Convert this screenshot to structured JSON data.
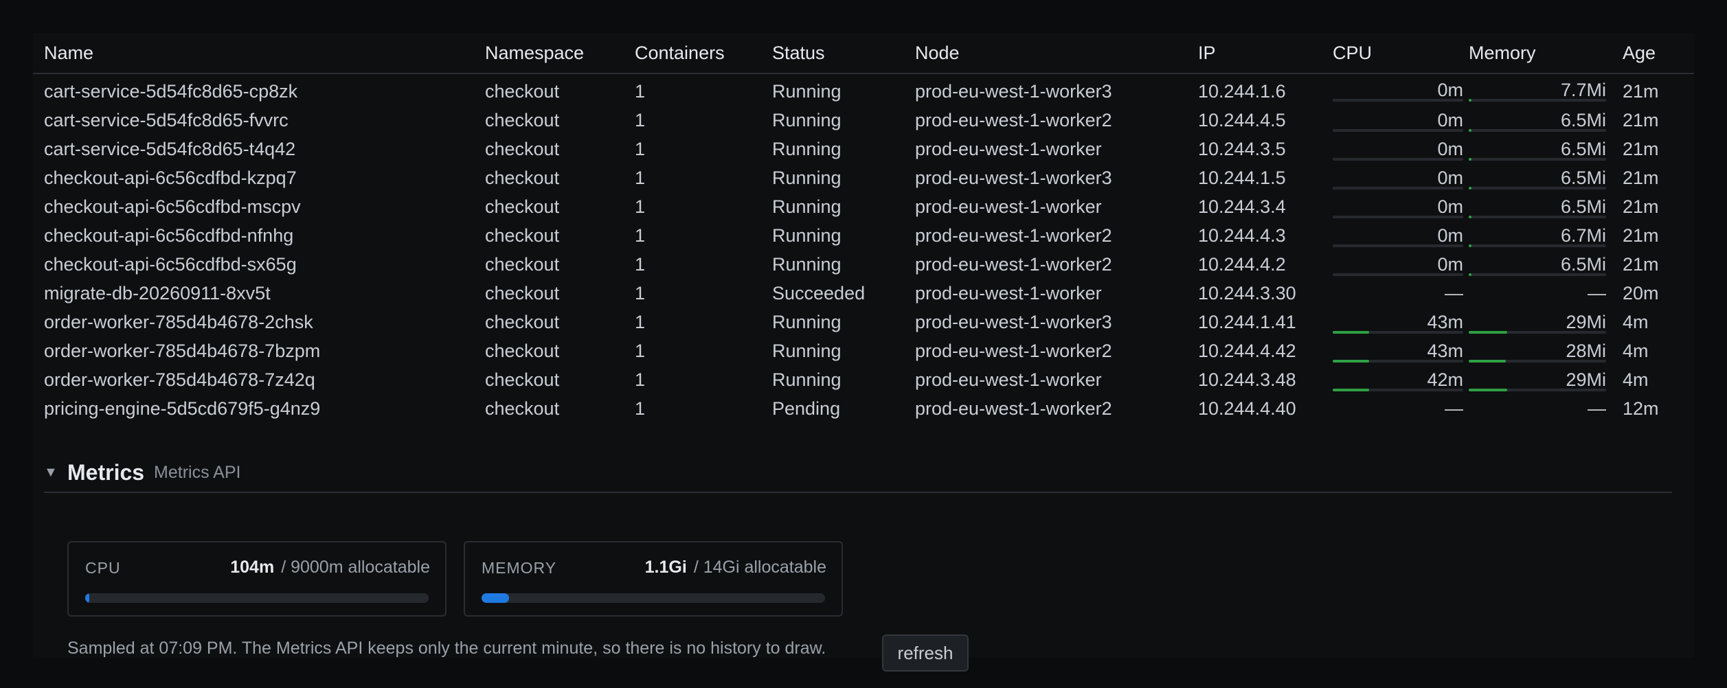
{
  "table": {
    "columns": {
      "name": "Name",
      "namespace": "Namespace",
      "containers": "Containers",
      "status": "Status",
      "node": "Node",
      "ip": "IP",
      "cpu": "CPU",
      "memory": "Memory",
      "age": "Age"
    },
    "rows": [
      {
        "name": "cart-service-5d54fc8d65-cp8zk",
        "namespace": "checkout",
        "containers": "1",
        "status": "Running",
        "node": "prod-eu-west-1-worker3",
        "ip": "10.244.1.6",
        "cpu": "0m",
        "cpu_level": 0.0,
        "memory": "7.7Mi",
        "mem_level": 0.01,
        "age": "21m"
      },
      {
        "name": "cart-service-5d54fc8d65-fvvrc",
        "namespace": "checkout",
        "containers": "1",
        "status": "Running",
        "node": "prod-eu-west-1-worker2",
        "ip": "10.244.4.5",
        "cpu": "0m",
        "cpu_level": 0.0,
        "memory": "6.5Mi",
        "mem_level": 0.01,
        "age": "21m"
      },
      {
        "name": "cart-service-5d54fc8d65-t4q42",
        "namespace": "checkout",
        "containers": "1",
        "status": "Running",
        "node": "prod-eu-west-1-worker",
        "ip": "10.244.3.5",
        "cpu": "0m",
        "cpu_level": 0.0,
        "memory": "6.5Mi",
        "mem_level": 0.01,
        "age": "21m"
      },
      {
        "name": "checkout-api-6c56cdfbd-kzpq7",
        "namespace": "checkout",
        "containers": "1",
        "status": "Running",
        "node": "prod-eu-west-1-worker3",
        "ip": "10.244.1.5",
        "cpu": "0m",
        "cpu_level": 0.0,
        "memory": "6.5Mi",
        "mem_level": 0.01,
        "age": "21m"
      },
      {
        "name": "checkout-api-6c56cdfbd-mscpv",
        "namespace": "checkout",
        "containers": "1",
        "status": "Running",
        "node": "prod-eu-west-1-worker",
        "ip": "10.244.3.4",
        "cpu": "0m",
        "cpu_level": 0.0,
        "memory": "6.5Mi",
        "mem_level": 0.01,
        "age": "21m"
      },
      {
        "name": "checkout-api-6c56cdfbd-nfnhg",
        "namespace": "checkout",
        "containers": "1",
        "status": "Running",
        "node": "prod-eu-west-1-worker2",
        "ip": "10.244.4.3",
        "cpu": "0m",
        "cpu_level": 0.0,
        "memory": "6.7Mi",
        "mem_level": 0.01,
        "age": "21m"
      },
      {
        "name": "checkout-api-6c56cdfbd-sx65g",
        "namespace": "checkout",
        "containers": "1",
        "status": "Running",
        "node": "prod-eu-west-1-worker2",
        "ip": "10.244.4.2",
        "cpu": "0m",
        "cpu_level": 0.0,
        "memory": "6.5Mi",
        "mem_level": 0.01,
        "age": "21m"
      },
      {
        "name": "migrate-db-20260911-8xv5t",
        "namespace": "checkout",
        "containers": "1",
        "status": "Succeeded",
        "node": "prod-eu-west-1-worker",
        "ip": "10.244.3.30",
        "cpu": "—",
        "cpu_level": null,
        "memory": "—",
        "mem_level": null,
        "age": "20m"
      },
      {
        "name": "order-worker-785d4b4678-2chsk",
        "namespace": "checkout",
        "containers": "1",
        "status": "Running",
        "node": "prod-eu-west-1-worker3",
        "ip": "10.244.1.41",
        "cpu": "43m",
        "cpu_level": 0.28,
        "memory": "29Mi",
        "mem_level": 0.28,
        "age": "4m"
      },
      {
        "name": "order-worker-785d4b4678-7bzpm",
        "namespace": "checkout",
        "containers": "1",
        "status": "Running",
        "node": "prod-eu-west-1-worker2",
        "ip": "10.244.4.42",
        "cpu": "43m",
        "cpu_level": 0.28,
        "memory": "28Mi",
        "mem_level": 0.27,
        "age": "4m"
      },
      {
        "name": "order-worker-785d4b4678-7z42q",
        "namespace": "checkout",
        "containers": "1",
        "status": "Running",
        "node": "prod-eu-west-1-worker",
        "ip": "10.244.3.48",
        "cpu": "42m",
        "cpu_level": 0.28,
        "memory": "29Mi",
        "mem_level": 0.28,
        "age": "4m"
      },
      {
        "name": "pricing-engine-5d5cd679f5-g4nz9",
        "namespace": "checkout",
        "containers": "1",
        "status": "Pending",
        "node": "prod-eu-west-1-worker2",
        "ip": "10.244.4.40",
        "cpu": "—",
        "cpu_level": null,
        "memory": "—",
        "mem_level": null,
        "age": "12m"
      }
    ]
  },
  "metrics": {
    "caret": "▼",
    "title": "Metrics",
    "subtitle": "Metrics API",
    "cpu": {
      "label": "CPU",
      "value": "104m",
      "suffix": "/ 9000m allocatable",
      "level": 0.012
    },
    "memory": {
      "label": "MEMORY",
      "value": "1.1Gi",
      "suffix": "/ 14Gi allocatable",
      "level": 0.08
    },
    "note": "Sampled at 07:09 PM. The Metrics API keeps only the current minute, so there is no history to draw.",
    "refresh_label": "refresh"
  },
  "colors": {
    "bar_green": "#2ea043",
    "bar_blue": "#1f7ae0"
  }
}
